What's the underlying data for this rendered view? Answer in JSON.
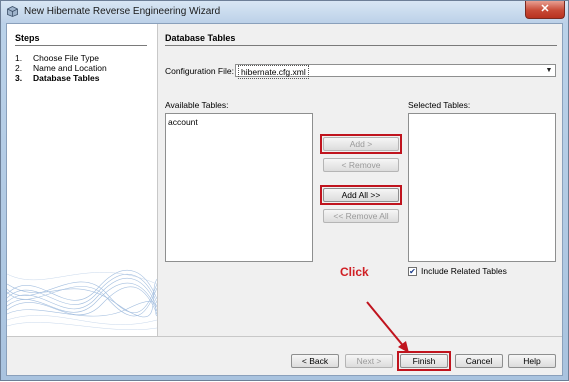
{
  "window": {
    "title": "New Hibernate Reverse Engineering Wizard",
    "close_glyph": "✕",
    "accent": "#c0141e"
  },
  "steps": {
    "title": "Steps",
    "items": [
      {
        "num": "1.",
        "label": "Choose File Type",
        "active": false
      },
      {
        "num": "2.",
        "label": "Name and Location",
        "active": false
      },
      {
        "num": "3.",
        "label": "Database Tables",
        "active": true
      }
    ]
  },
  "content": {
    "title": "Database Tables",
    "config_label": "Configuration File:",
    "config_value": "hibernate.cfg.xml",
    "available_label": "Available Tables:",
    "available_items": [
      "account"
    ],
    "selected_label": "Selected Tables:",
    "selected_items": [],
    "include_related_label": "Include Related Tables",
    "include_related_checked": true
  },
  "transfer_buttons": {
    "add": "Add >",
    "remove": "< Remove",
    "add_all": "Add All >>",
    "remove_all": "<< Remove All"
  },
  "footer": {
    "back": "< Back",
    "next": "Next >",
    "finish": "Finish",
    "cancel": "Cancel",
    "help": "Help"
  },
  "annotation": {
    "text": "Click"
  },
  "icons": {
    "window_icon": "cube-icon",
    "dropdown": "chevron-down-icon",
    "check": "checkmark-icon"
  }
}
